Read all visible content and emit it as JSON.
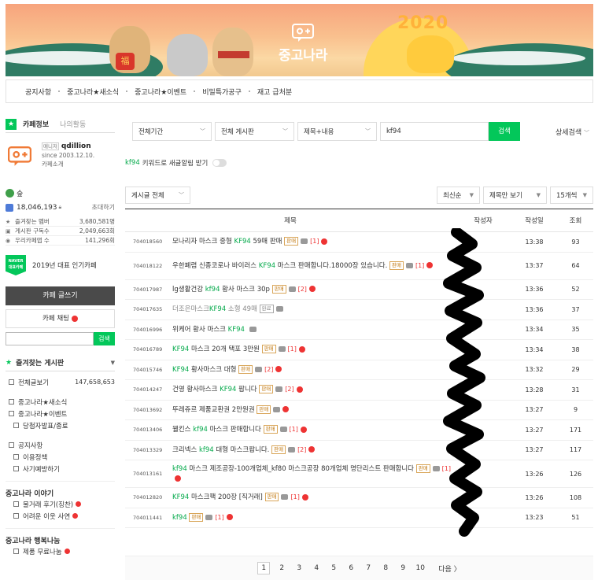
{
  "banner": {
    "year": "2020",
    "brand": "중고나라",
    "hanja": "福"
  },
  "topmenu": [
    "공지사항",
    "중고나라★새소식",
    "중고나라★이벤트",
    "비밀특가공구",
    "재고 급처분"
  ],
  "sidebar": {
    "tab_info": "카페정보",
    "tab_activity": "나의활동",
    "manager_label": "매니저",
    "manager_nick": "qdillion",
    "since": "since 2003.12.10.",
    "intro": "카페소개",
    "grade": "숲",
    "members": "18,046,193",
    "invite": "초대하기",
    "stats": [
      {
        "icon": "★",
        "label": "즐겨찾는 멤버",
        "value": "3,680,581명"
      },
      {
        "icon": "▣",
        "label": "게시판 구독수",
        "value": "2,049,663회"
      },
      {
        "icon": "◉",
        "label": "우리카페앱 수",
        "value": "141,296회"
      }
    ],
    "naver_badge_top": "NAVER",
    "naver_badge_bottom": "대표카페",
    "badge_text": "2019년 대표 인기카페",
    "write_btn": "카페 글쓰기",
    "chat_btn": "카페 채팅",
    "search_btn": "검색",
    "fav_title": "즐겨찾는 게시판",
    "all_posts": "전체글보기",
    "all_count": "147,658,653",
    "menu_group1": [
      {
        "label": "중고나라★새소식",
        "sub": false
      },
      {
        "label": "중고나라★이벤트",
        "sub": false
      },
      {
        "label": "당첨자발표/종료",
        "sub": true
      }
    ],
    "menu_group2": [
      {
        "label": "공지사항",
        "sub": false
      },
      {
        "label": "이용정책",
        "sub": true
      },
      {
        "label": "사기예방하기",
        "sub": true
      }
    ],
    "section_story": "중고나라 이야기",
    "story_items": [
      "물거래 후기(징찬)",
      "어려운 이웃 사연"
    ],
    "section_share": "중고나라 행복나눔",
    "share_items": [
      "제품 무료나눔"
    ]
  },
  "search": {
    "period": "전체기간",
    "board": "전체 게시판",
    "field": "제목+내용",
    "query": "kf94",
    "button": "검색",
    "advanced": "상세검색"
  },
  "alert": {
    "keyword": "kf94",
    "text": "키워드로 새글알림 받기"
  },
  "listbar": {
    "filter": "게시글 전체",
    "sort": "최신순",
    "view": "제목만 보기",
    "per_page": "15개씩"
  },
  "table": {
    "headers": {
      "title": "제목",
      "author": "작성자",
      "date": "작성일",
      "views": "조회"
    },
    "rows": [
      {
        "num": "704018560",
        "pre": "모나리자 마스크 중형 ",
        "kw": "KF94",
        "post": " 59매 판매",
        "tag": "판매",
        "cam": true,
        "cmt": "[1]",
        "new": true,
        "author": "",
        "date": "13:38",
        "views": "93",
        "gray": false,
        "tall": false
      },
      {
        "num": "704018122",
        "pre": "우한폐렴 신종코로나 바이러스 ",
        "kw": "KF94",
        "post": " 마스크 판매합니다.18000장 있습니다.",
        "tag": "판매",
        "cam": true,
        "cmt": "[1]",
        "new": true,
        "author": "",
        "date": "13:37",
        "views": "64",
        "gray": false,
        "tall": true
      },
      {
        "num": "704017987",
        "pre": "lg생활건강 ",
        "kw": "kf94",
        "post": " 황사 마스크 30p",
        "tag": "판매",
        "cam": true,
        "cmt": "[2]",
        "new": true,
        "author": "",
        "date": "13:36",
        "views": "52",
        "gray": false,
        "tall": false
      },
      {
        "num": "704017635",
        "pre": "더조은마스크",
        "kw": "KF94",
        "post": " 소형 49매",
        "tag": "완료",
        "cam": true,
        "cmt": "",
        "new": false,
        "author": "",
        "date": "13:36",
        "views": "37",
        "gray": true,
        "tall": false
      },
      {
        "num": "704016996",
        "pre": "위케어 황사 마스크 ",
        "kw": "KF94",
        "post": "",
        "tag": "",
        "cam": true,
        "cmt": "",
        "new": false,
        "author": "",
        "date": "13:34",
        "views": "35",
        "gray": false,
        "tall": false
      },
      {
        "num": "704016789",
        "pre": "",
        "kw": "KF94",
        "post": " 마스크 20개 택포 3만원",
        "tag": "판매",
        "cam": true,
        "cmt": "[1]",
        "new": true,
        "author": "",
        "date": "13:34",
        "views": "38",
        "gray": false,
        "tall": false
      },
      {
        "num": "704015746",
        "pre": "",
        "kw": "KF94",
        "post": " 황사마스크 대형",
        "tag": "판매",
        "cam": true,
        "cmt": "[2]",
        "new": true,
        "author": "",
        "date": "13:32",
        "views": "29",
        "gray": false,
        "tall": false
      },
      {
        "num": "704014247",
        "pre": "건영 황사마스크 ",
        "kw": "KF94",
        "post": " 팝니다",
        "tag": "판매",
        "cam": true,
        "cmt": "[2]",
        "new": true,
        "author": "",
        "date": "13:28",
        "views": "31",
        "gray": false,
        "tall": false
      },
      {
        "num": "704013692",
        "pre": "뚜레쥬르 제품교환권 2만원권",
        "kw": "",
        "post": "",
        "tag": "판매",
        "cam": true,
        "cmt": "",
        "new": true,
        "author": "",
        "date": "13:27",
        "views": "9",
        "gray": false,
        "tall": false
      },
      {
        "num": "704013406",
        "pre": "웰킨스 ",
        "kw": "kf94",
        "post": " 마스크 판매합니다",
        "tag": "판매",
        "cam": true,
        "cmt": "[1]",
        "new": true,
        "author": "",
        "date": "13:27",
        "views": "171",
        "gray": false,
        "tall": false
      },
      {
        "num": "704013329",
        "pre": "크리넥스 ",
        "kw": "kf94",
        "post": " 대형 마스크팝니다.",
        "tag": "판매",
        "cam": true,
        "cmt": "[2]",
        "new": true,
        "author": "",
        "date": "13:27",
        "views": "117",
        "gray": false,
        "tall": false
      },
      {
        "num": "704013161",
        "pre": "",
        "kw": "kf94",
        "post": " 마스크 제조공장-100개업체_kf80 마스크공장 80개업체 명단리스트 판매합니다",
        "tag": "판매",
        "cam": true,
        "cmt": "[1]",
        "new": true,
        "author": "",
        "date": "13:26",
        "views": "126",
        "gray": false,
        "tall": true
      },
      {
        "num": "704012820",
        "pre": "",
        "kw": "KF94",
        "post": " 마스크팩 200장 [직거래]",
        "tag": "판매",
        "cam": true,
        "cmt": "[1]",
        "new": true,
        "author": "",
        "date": "13:26",
        "views": "108",
        "gray": false,
        "tall": false
      },
      {
        "num": "704011441",
        "pre": "",
        "kw": "kf94",
        "post": "",
        "tag": "판매",
        "cam": true,
        "cmt": "[1]",
        "new": true,
        "author": "",
        "date": "13:23",
        "views": "51",
        "gray": false,
        "tall": false
      }
    ]
  },
  "pager": {
    "pages": [
      "1",
      "2",
      "3",
      "4",
      "5",
      "6",
      "7",
      "8",
      "9",
      "10"
    ],
    "next": "다음 〉"
  }
}
